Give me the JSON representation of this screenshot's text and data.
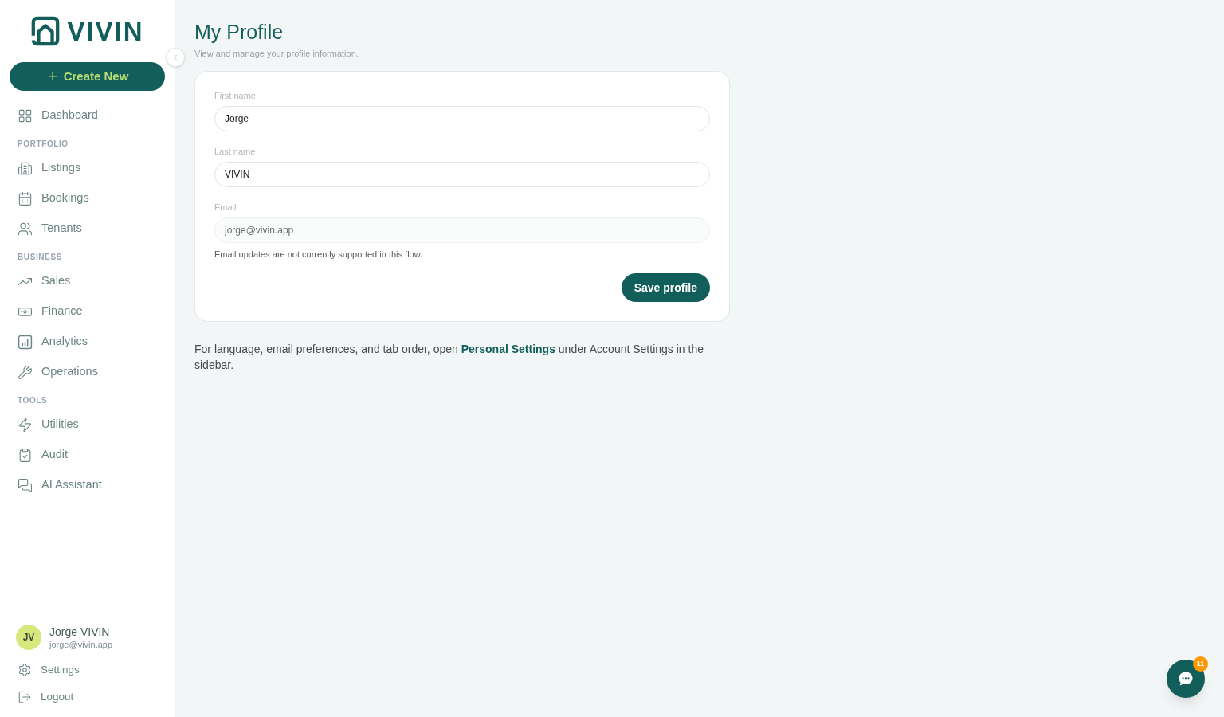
{
  "sidebar": {
    "logo_text": "VIVIN",
    "create_button": "Create New",
    "nav": [
      {
        "kind": "item",
        "label": "Dashboard",
        "selected": false
      },
      {
        "kind": "heading",
        "label": "PORTFOLIO"
      },
      {
        "kind": "item",
        "label": "Listings",
        "selected": false
      },
      {
        "kind": "item",
        "label": "Bookings",
        "selected": false
      },
      {
        "kind": "item",
        "label": "Tenants",
        "selected": false
      },
      {
        "kind": "heading",
        "label": "BUSINESS"
      },
      {
        "kind": "item",
        "label": "Sales",
        "selected": false
      },
      {
        "kind": "item",
        "label": "Finance",
        "selected": false
      },
      {
        "kind": "item",
        "label": "Analytics",
        "selected": false
      },
      {
        "kind": "item",
        "label": "Operations",
        "selected": false
      },
      {
        "kind": "heading",
        "label": "TOOLS"
      },
      {
        "kind": "item",
        "label": "Utilities",
        "selected": false
      },
      {
        "kind": "item",
        "label": "Audit",
        "selected": false
      },
      {
        "kind": "item",
        "label": "AI Assistant",
        "selected": false
      }
    ],
    "user": {
      "initials": "JV",
      "name": "Jorge VIVIN",
      "email": "jorge@vivin.app"
    },
    "footer_links": [
      {
        "label": "Settings"
      },
      {
        "label": "Logout"
      }
    ]
  },
  "page": {
    "title": "My Profile",
    "subtitle": "View and manage your profile information."
  },
  "profile_form": {
    "fields": [
      {
        "label": "First name",
        "value": "Jorge",
        "disabled": false
      },
      {
        "label": "Last name",
        "value": "VIVIN",
        "disabled": false
      },
      {
        "label": "Email",
        "value": "jorge@vivin.app",
        "disabled": true,
        "note": "Email updates are not currently supported in this flow."
      }
    ],
    "submit_button": "Save profile"
  },
  "settings_note": {
    "before": "For language, email preferences, and tab order, open ",
    "link": "Personal Settings",
    "after": " under Account Settings in the sidebar."
  },
  "chat_button": {
    "badge": "11"
  }
}
